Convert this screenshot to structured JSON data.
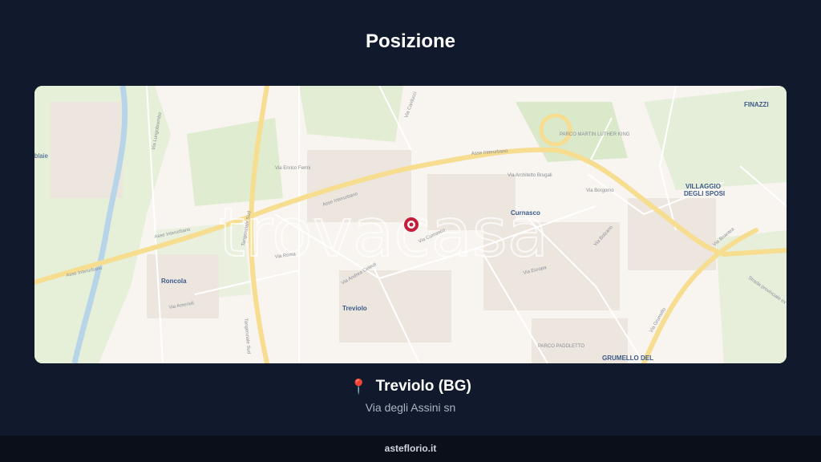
{
  "page": {
    "title": "Posizione"
  },
  "map": {
    "watermark": "trovacasa",
    "place_labels": {
      "treviolo": "Treviolo",
      "curnasco": "Curnasco",
      "roncola": "Roncola",
      "villaggio_line1": "VILLAGGIO",
      "villaggio_line2": "DEGLI SPOSI",
      "finazzi": "FINAZZI",
      "grumello": "GRUMELLO DEL",
      "blaie": "blaie"
    },
    "road_labels": {
      "asse_left": "Asse Interurbano",
      "asse_mid": "Asse Interurbano",
      "asse_top": "Asse Interurbano",
      "asse_center": "Asse Interurbano",
      "tangenziale": "Tangenziale Sud",
      "tangenziale2": "Tangenziale Sud",
      "via_roma": "Via Roma",
      "via_europa": "Via Europa",
      "via_bolzano": "Via Bolzano",
      "via_amerioli": "Via Amerioli",
      "via_grumello": "Via Grumello",
      "via_briantea": "Via Briantea",
      "via_carducci": "Via Carducci",
      "via_enrico_fermi": "Via Enrico Fermi",
      "via_brugali": "Via Architetto Brugali",
      "via_borgomo": "Via Borgomo",
      "via_lungobrembo": "Via Lungobrembo",
      "via_curnasco": "Via Curnasco",
      "via_andrea_celesti": "Via Andrea Celesti",
      "parco_mlk": "PARCO MARTIN LUTHER KING",
      "parco_paddletto": "PARCO PADDLETTO",
      "strada_prov": "Strada provinciale ex SS"
    },
    "pin_color": "#c41e3a"
  },
  "location": {
    "pin_icon": "📍",
    "title": "Treviolo (BG)",
    "address": "Via degli Assini sn"
  },
  "footer": {
    "text": "asteflorio.it"
  }
}
